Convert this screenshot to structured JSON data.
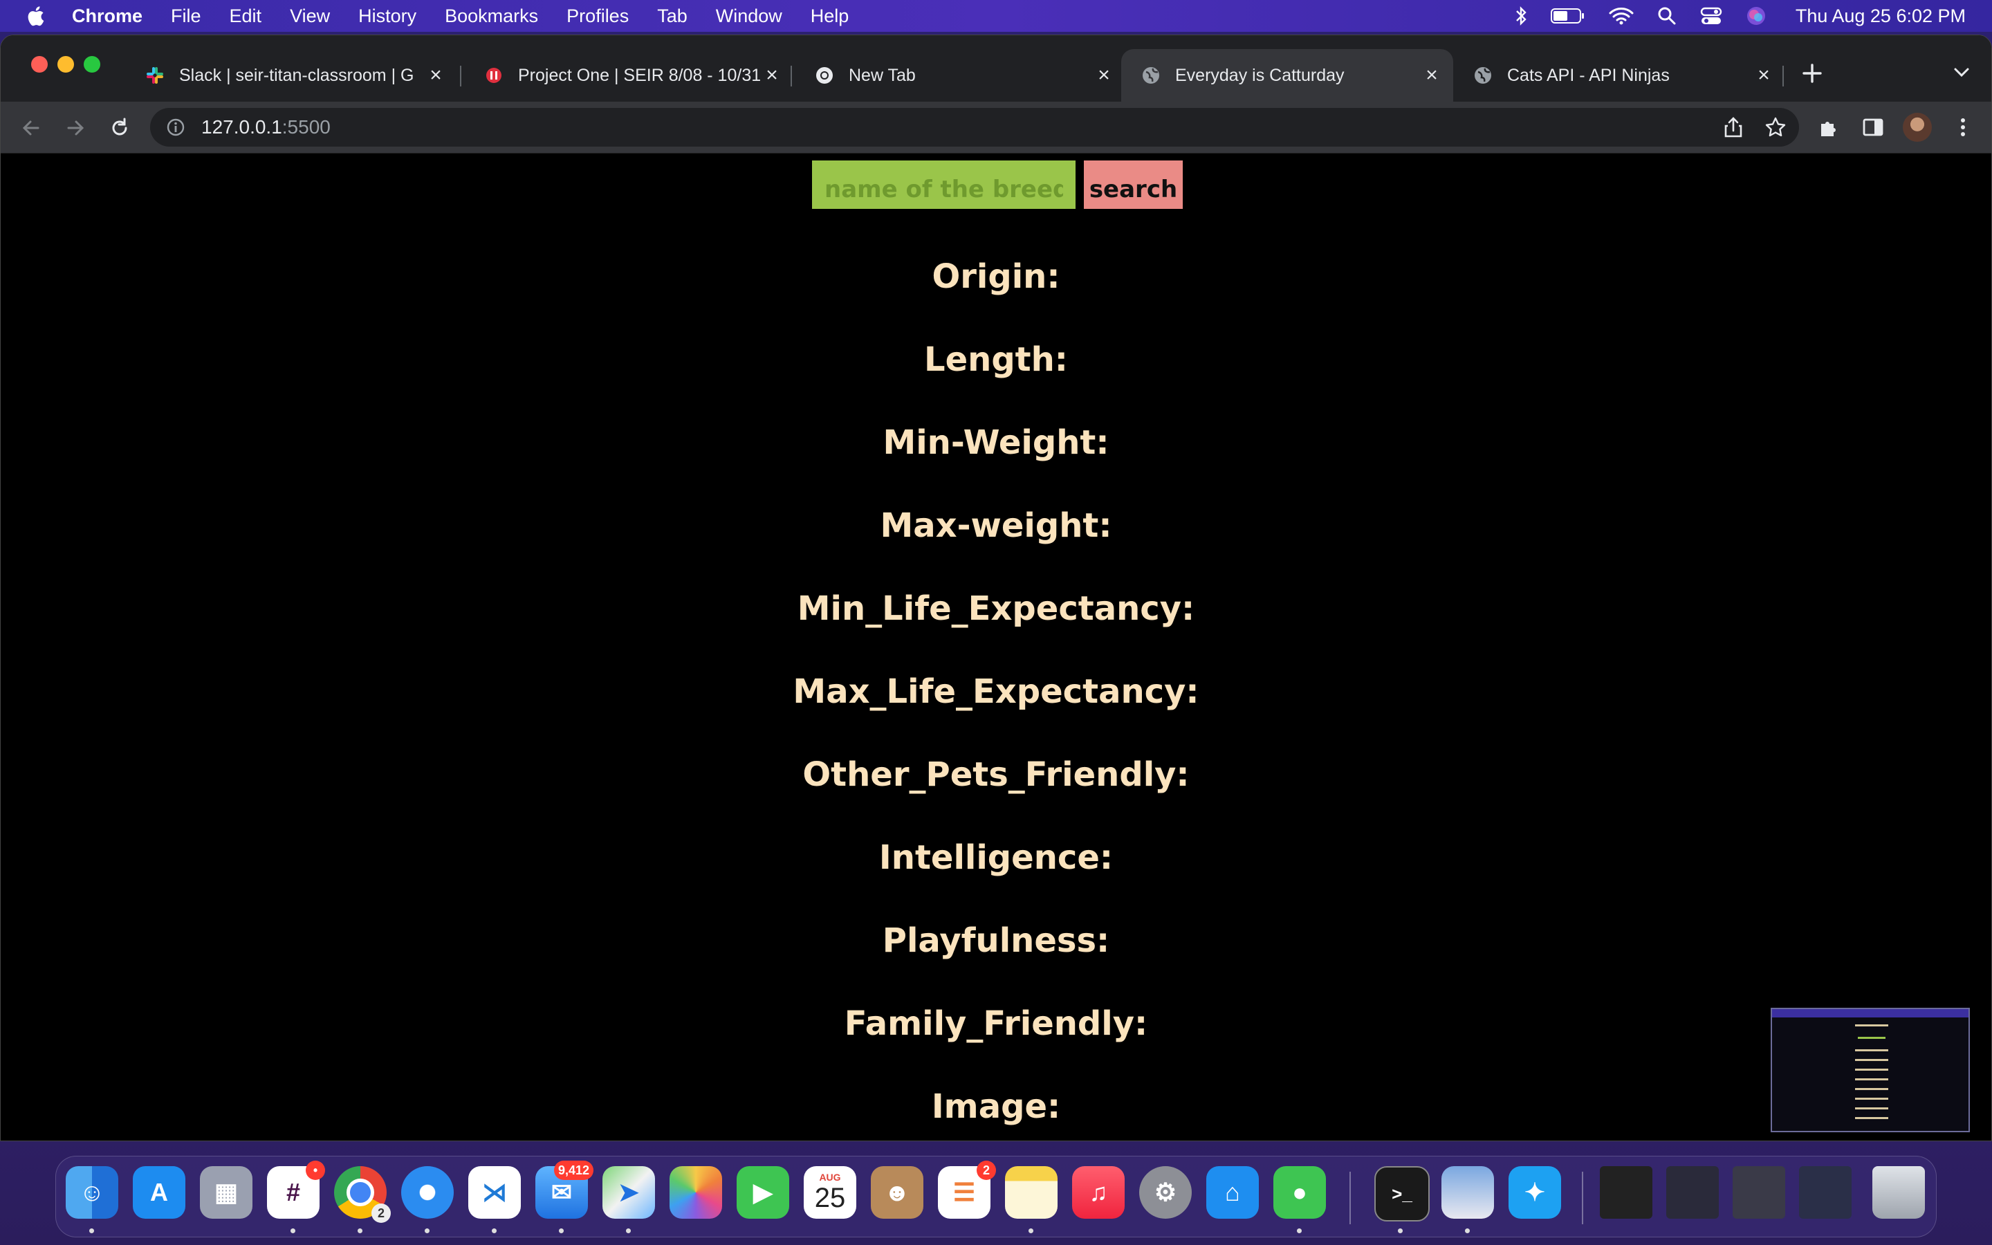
{
  "menubar": {
    "app": "Chrome",
    "items": [
      "File",
      "Edit",
      "View",
      "History",
      "Bookmarks",
      "Profiles",
      "Tab",
      "Window",
      "Help"
    ],
    "clock": "Thu Aug 25  6:02 PM"
  },
  "tabs": [
    {
      "title": "Slack | seir-titan-classroom | G",
      "favicon": "slack-icon"
    },
    {
      "title": "Project One | SEIR 8/08 - 10/31",
      "favicon": "ga-icon"
    },
    {
      "title": "New Tab",
      "favicon": "chrome-icon"
    },
    {
      "title": "Everyday is Catturday",
      "favicon": "globe-icon",
      "active": true
    },
    {
      "title": "Cats API - API Ninjas",
      "favicon": "globe-icon"
    }
  ],
  "address": {
    "host": "127.0.0.1",
    "port": ":5500"
  },
  "page": {
    "search_placeholder": "name of the breed",
    "search_button": "search",
    "fields": [
      "Origin:",
      "Length:",
      "Min-Weight:",
      "Max-weight:",
      "Min_Life_Expectancy:",
      "Max_Life_Expectancy:",
      "Other_Pets_Friendly:",
      "Intelligence:",
      "Playfulness:",
      "Family_Friendly:",
      "Image:"
    ]
  },
  "dock": {
    "slack_badge": "•",
    "chrome_badge": "2",
    "mail_badge": "9,412",
    "calendar_month": "AUG",
    "calendar_day": "25",
    "reminders_badge": "2"
  },
  "colors": {
    "field_text": "#fbe3bd",
    "input_bg": "#9ac54a",
    "button_bg": "#ea8b86"
  }
}
